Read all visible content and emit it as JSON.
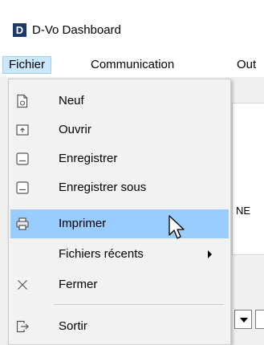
{
  "window": {
    "logo_letter": "D",
    "title": "D-Vo Dashboard"
  },
  "menubar": {
    "items": [
      {
        "label": "Fichier",
        "active": true
      },
      {
        "label": "Communication",
        "active": false
      },
      {
        "label": "Out",
        "active": false
      }
    ]
  },
  "background": {
    "partial_text": "NE"
  },
  "file_menu": {
    "items": [
      {
        "label": "Neuf",
        "icon": "new-file-icon"
      },
      {
        "label": "Ouvrir",
        "icon": "open-icon"
      },
      {
        "label": "Enregistrer",
        "icon": "save-icon"
      },
      {
        "label": "Enregistrer sous",
        "icon": "save-as-icon"
      },
      {
        "label": "Imprimer",
        "icon": "print-icon",
        "highlighted": true
      },
      {
        "label": "Fichiers récents",
        "icon": "",
        "has_submenu": true
      },
      {
        "label": "Fermer",
        "icon": "close-icon"
      },
      {
        "label": "Sortir",
        "icon": "exit-icon"
      }
    ]
  },
  "colors": {
    "highlight": "#99ccff",
    "menu_active": "#cce8ff",
    "logo_bg": "#1b3a6b"
  }
}
